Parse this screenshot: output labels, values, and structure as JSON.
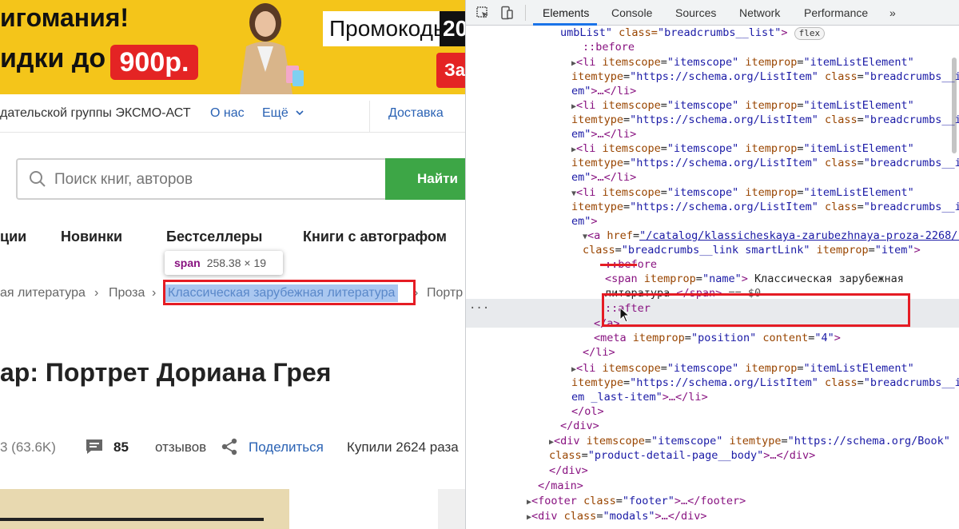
{
  "banner": {
    "line1": "игомания!",
    "line2": "идки до",
    "price": "900р.",
    "promo": "Промокоды",
    "promo_year": "20",
    "promo_sub": "За"
  },
  "topnav": {
    "publisher": "дательской группы ЭКСМО-АСТ",
    "about": "О нас",
    "more": "Ещё",
    "delivery": "Доставка"
  },
  "search": {
    "placeholder": "Поиск книг, авторов",
    "button": "Найти"
  },
  "categories": {
    "c1": "ции",
    "c2": "Новинки",
    "c3": "Бестселлеры",
    "c4": "Книги с автографом"
  },
  "tooltip": {
    "tag": "span",
    "dims": "258.38 × 19"
  },
  "breadcrumbs": {
    "b1": "ая литература",
    "sep": "›",
    "b2": "Проза",
    "b3": "Классическая зарубежная литература",
    "b4": "Портр"
  },
  "product": {
    "title": "ар: Портрет Дориана Грея",
    "rating": "3 (63.6K)",
    "reviews_count": "85",
    "reviews_label": "отзывов",
    "share": "Поделиться",
    "bought": "Купили 2624 раза"
  },
  "devtools": {
    "tabs": [
      "Elements",
      "Console",
      "Sources",
      "Network",
      "Performance",
      "»"
    ],
    "active_tab": "Elements",
    "lines": {
      "l0a": "umbList\"",
      "l0b": " class=",
      "l0c": "\"breadcrumbs__list\"",
      "l0d": ">",
      "flex": "flex",
      "before": "::before",
      "after": "::after",
      "li_open": "<li",
      "itemscope_attr": " itemscope",
      "eq": "=",
      "itemscope_val": "\"itemscope\"",
      "itemprop_attr": " itemprop",
      "itemprop_val": "\"itemListElement\"",
      "itemtype_attr": "itemtype",
      "itemtype_val": "\"https://schema.org/ListItem\"",
      "class_attr": " class",
      "class_val_a": "\"breadcrumbs__it",
      "class_val_b": "em\"",
      "ellipsis_close": ">…</li>",
      "gt": ">",
      "a_open": "<a",
      "href_attr": " href",
      "href_val": "\"/catalog/klassicheskaya-zarubezhnaya-proza-2268/\"",
      "a_class_attr": "class",
      "a_class_val": "\"breadcrumbs__link smartLink\"",
      "a_itemprop_val": "\"item\"",
      "span_open": "<span",
      "span_itemprop_val": "\"name\"",
      "span_text_a": " Классическая зарубежная",
      "span_text_b": "литература ",
      "span_close": "</span>",
      "eq0": " == $0",
      "a_close": "</a>",
      "meta_open": "<meta",
      "meta_itemprop_val": "\"position\"",
      "meta_content_attr": " content",
      "meta_content_val": "\"4\"",
      "li_close": "</li>",
      "class_val_last": "\"breadcrumbs__it",
      "last_b": "em _last-item\"",
      "ol_close": "</ol>",
      "div_close": "</div>",
      "div_open": "<div",
      "book_type_val": "\"https://schema.org/Book\"",
      "div_class_attr": "class",
      "div_class_val": "\"product-detail-page__body\"",
      "div_tail": ">…</div>",
      "main_close": "</main>",
      "footer_open": "<footer",
      "footer_class_val": "\"footer\"",
      "footer_tail": ">…</footer>",
      "modals_class_val": "\"modals\"",
      "dots": "..."
    }
  },
  "colors": {
    "banner_yellow": "#f4c51a",
    "banner_red": "#e42424",
    "search_green": "#3da646",
    "link_blue": "#2a62b4",
    "highlight_red": "#e51c24",
    "selection_bg": "#aac7f0"
  }
}
